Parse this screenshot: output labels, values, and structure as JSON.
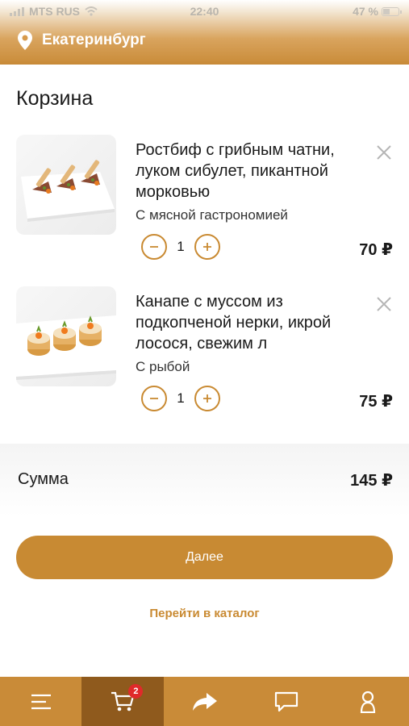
{
  "status_bar": {
    "carrier": "MTS RUS",
    "time": "22:40",
    "battery": "47 %",
    "battery_level": 0.47
  },
  "header": {
    "city": "Екатеринбург"
  },
  "cart": {
    "title": "Корзина",
    "items": [
      {
        "name": "Ростбиф с грибным чатни, луком сибулет, пикантной морковью",
        "category": "С мясной гастрономией",
        "quantity": "1",
        "price": "70 ₽"
      },
      {
        "name": "Канапе с муссом из подкопченой нерки, икрой лосося, свежим л",
        "category": "С рыбой",
        "quantity": "1",
        "price": "75 ₽"
      }
    ]
  },
  "summary": {
    "label": "Сумма",
    "value": "145 ₽"
  },
  "actions": {
    "next_label": "Далее",
    "catalog_label": "Перейти в каталог"
  },
  "tabbar": {
    "active": "cart",
    "cart_badge": "2",
    "tabs": [
      {
        "icon": "menu-icon"
      },
      {
        "icon": "cart-icon"
      },
      {
        "icon": "share-icon"
      },
      {
        "icon": "chat-icon"
      },
      {
        "icon": "user-icon"
      }
    ]
  },
  "colors": {
    "accent": "#c98a32",
    "tab_active": "#8f5a1d",
    "badge": "#e02a2a"
  }
}
